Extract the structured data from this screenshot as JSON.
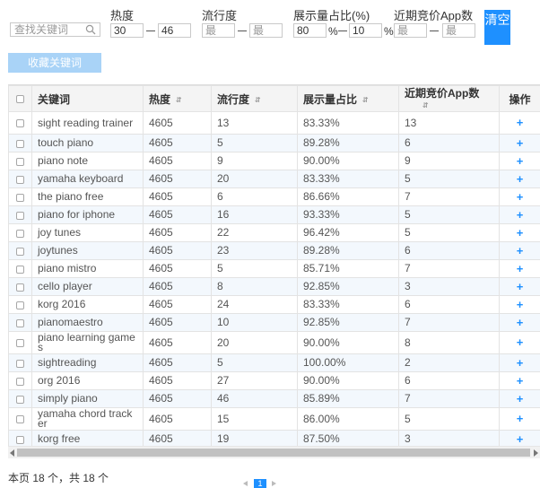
{
  "filters": {
    "search_placeholder": "查找关键词",
    "heat_label": "热度",
    "heat_min": "30",
    "heat_max": "46",
    "popularity_label": "流行度",
    "popularity_min_placeholder": "最",
    "popularity_max_placeholder": "最",
    "share_label": "展示量占比(%)",
    "share_min": "80",
    "share_max": "10",
    "percent_sign": "%",
    "apps_label": "近期竞价App数",
    "apps_min_placeholder": "最",
    "apps_max_placeholder": "最",
    "clear_label": "清空"
  },
  "fav_button_label": "收藏关键词",
  "table": {
    "headers": {
      "keyword": "关键词",
      "heat": "热度",
      "popularity": "流行度",
      "share": "展示量占比",
      "apps": "近期竞价App数",
      "actions": "操作"
    },
    "sort_glyph": "⇵",
    "add_glyph": "+",
    "rows": [
      {
        "keyword": "sight reading trainer",
        "heat": "4605",
        "popularity": "13",
        "share": "83.33%",
        "apps": "13"
      },
      {
        "keyword": "touch piano",
        "heat": "4605",
        "popularity": "5",
        "share": "89.28%",
        "apps": "6"
      },
      {
        "keyword": "piano note",
        "heat": "4605",
        "popularity": "9",
        "share": "90.00%",
        "apps": "9"
      },
      {
        "keyword": "yamaha keyboard",
        "heat": "4605",
        "popularity": "20",
        "share": "83.33%",
        "apps": "5"
      },
      {
        "keyword": "the piano free",
        "heat": "4605",
        "popularity": "6",
        "share": "86.66%",
        "apps": "7"
      },
      {
        "keyword": "piano for iphone",
        "heat": "4605",
        "popularity": "16",
        "share": "93.33%",
        "apps": "5"
      },
      {
        "keyword": "joy tunes",
        "heat": "4605",
        "popularity": "22",
        "share": "96.42%",
        "apps": "5"
      },
      {
        "keyword": "joytunes",
        "heat": "4605",
        "popularity": "23",
        "share": "89.28%",
        "apps": "6"
      },
      {
        "keyword": "piano mistro",
        "heat": "4605",
        "popularity": "5",
        "share": "85.71%",
        "apps": "7"
      },
      {
        "keyword": "cello player",
        "heat": "4605",
        "popularity": "8",
        "share": "92.85%",
        "apps": "3"
      },
      {
        "keyword": "korg 2016",
        "heat": "4605",
        "popularity": "24",
        "share": "83.33%",
        "apps": "6"
      },
      {
        "keyword": "pianomaestro",
        "heat": "4605",
        "popularity": "10",
        "share": "92.85%",
        "apps": "7"
      },
      {
        "keyword": "piano learning games",
        "heat": "4605",
        "popularity": "20",
        "share": "90.00%",
        "apps": "8"
      },
      {
        "keyword": "sightreading",
        "heat": "4605",
        "popularity": "5",
        "share": "100.00%",
        "apps": "2"
      },
      {
        "keyword": "org 2016",
        "heat": "4605",
        "popularity": "27",
        "share": "90.00%",
        "apps": "6"
      },
      {
        "keyword": "simply piano",
        "heat": "4605",
        "popularity": "46",
        "share": "85.89%",
        "apps": "7"
      },
      {
        "keyword": "yamaha chord tracker",
        "heat": "4605",
        "popularity": "15",
        "share": "86.00%",
        "apps": "5"
      },
      {
        "keyword": "korg free",
        "heat": "4605",
        "popularity": "19",
        "share": "87.50%",
        "apps": "3"
      }
    ]
  },
  "page_info": "本页 18 个，共 18 个",
  "pager": {
    "current_page": "1"
  },
  "colors": {
    "accent": "#1e90ff",
    "fav_button": "#a9d3f7",
    "row_stripe": "#f3f8fd"
  }
}
